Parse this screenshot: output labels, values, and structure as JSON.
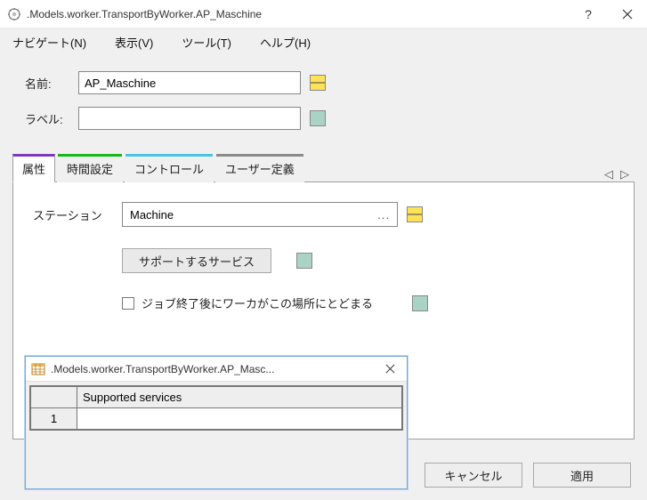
{
  "window": {
    "title": ".Models.worker.TransportByWorker.AP_Maschine"
  },
  "menu": {
    "navigate": "ナビゲート(N)",
    "view": "表示(V)",
    "tools": "ツール(T)",
    "help": "ヘルプ(H)"
  },
  "form": {
    "name_label": "名前:",
    "name_value": "AP_Maschine",
    "label_label": "ラベル:",
    "label_value": ""
  },
  "tabs": {
    "attr": "属性",
    "time": "時間設定",
    "control": "コントロール",
    "user": "ユーザー定義"
  },
  "panel": {
    "station_label": "ステーション",
    "station_value": "Machine",
    "services_btn": "サポートするサービス",
    "stay_label": "ジョブ終了後にワーカがこの場所にとどまる"
  },
  "footer": {
    "cancel": "キャンセル",
    "apply": "適用"
  },
  "sub": {
    "title": ".Models.worker.TransportByWorker.AP_Masc...",
    "col": "Supported services",
    "row1_idx": "1",
    "row1_val": ""
  }
}
